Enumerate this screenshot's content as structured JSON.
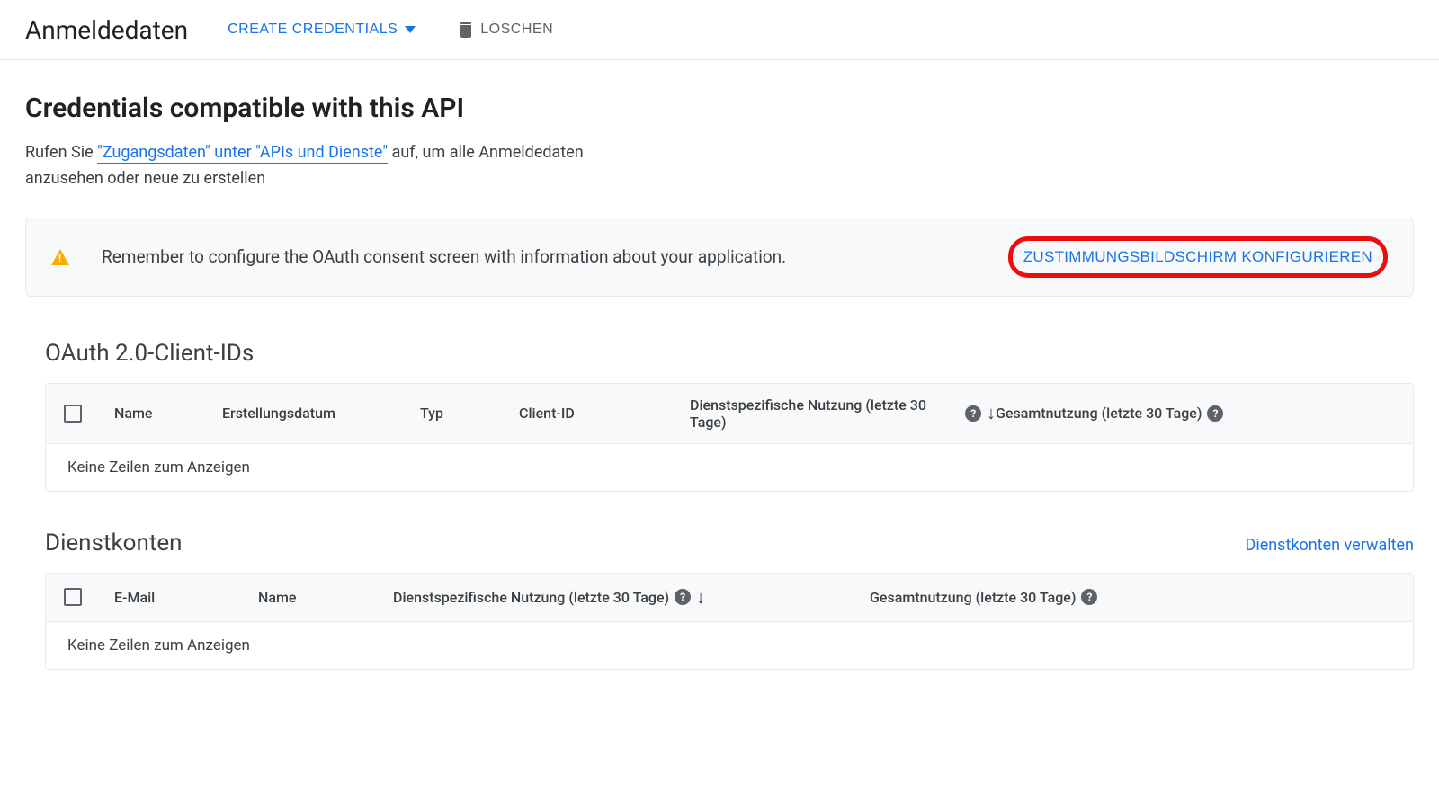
{
  "toolbar": {
    "title": "Anmeldedaten",
    "create_label": "CREATE CREDENTIALS",
    "delete_label": "LÖSCHEN"
  },
  "main": {
    "heading": "Credentials compatible with this API",
    "description_prefix": "Rufen Sie ",
    "description_link": "\"Zugangsdaten\" unter \"APIs und Dienste\"",
    "description_suffix": " auf, um alle Anmeldedaten anzusehen oder neue zu erstellen"
  },
  "banner": {
    "text": "Remember to configure the OAuth consent screen with information about your application.",
    "button_label": "ZUSTIMMUNGSBILDSCHIRM KONFIGURIEREN"
  },
  "oauth_table": {
    "title": "OAuth 2.0-Client-IDs",
    "headers": {
      "name": "Name",
      "created": "Erstellungsdatum",
      "type": "Typ",
      "client_id": "Client-ID",
      "service_usage": "Dienstspezifische Nutzung (letzte 30 Tage)",
      "total_usage": "Gesamtnutzung (letzte 30 Tage)"
    },
    "empty": "Keine Zeilen zum Anzeigen"
  },
  "service_accounts_table": {
    "title": "Dienstkonten",
    "manage_link": "Dienstkonten verwalten",
    "headers": {
      "email": "E-Mail",
      "name": "Name",
      "service_usage": "Dienstspezifische Nutzung (letzte 30 Tage)",
      "total_usage": "Gesamtnutzung (letzte 30 Tage)"
    },
    "empty": "Keine Zeilen zum Anzeigen"
  }
}
